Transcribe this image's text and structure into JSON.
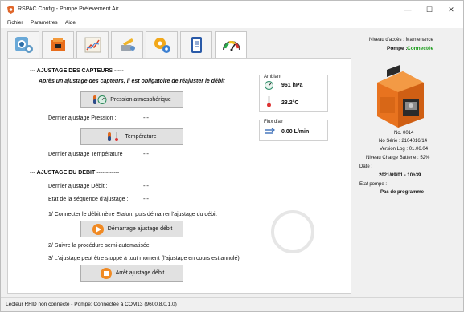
{
  "window": {
    "title": "RSPAC Config - Pompe Prélevement Air",
    "controls": [
      "—",
      "☐",
      "✕"
    ]
  },
  "menu": [
    "Fichier",
    "Paramètres",
    "Aide"
  ],
  "tabs": [
    {
      "icon": "sensor-tab-icon"
    },
    {
      "icon": "pump-tab-icon"
    },
    {
      "icon": "chart-tab-icon"
    },
    {
      "icon": "tools-tab-icon"
    },
    {
      "icon": "gears-tab-icon"
    },
    {
      "icon": "checklist-tab-icon"
    },
    {
      "icon": "gauge-tab-icon",
      "active": true
    }
  ],
  "calib": {
    "sensors_heading": "--- AJUSTAGE DES CAPTEURS -----",
    "sensors_warning": "Après un ajustage des capteurs, il est obligatoire de réajuster le débit",
    "pressure_button": "Pression atmosphérique",
    "last_pressure_label": "Dernier ajustage Pression :",
    "last_pressure_value": "---",
    "temperature_button": "Température",
    "last_temperature_label": "Dernier ajustage Température :",
    "last_temperature_value": "---",
    "flow_heading": "--- AJUSTAGE DU DEBIT ------------",
    "last_flow_label": "Dernier ajustage Débit :",
    "last_flow_value": "---",
    "sequence_label": "Etat de la séquence d'ajustage :",
    "sequence_value": "---",
    "step1": "1/ Connecter le débitmètre Etalon, puis démarrer l'ajustage du débit",
    "start_button": "Démarrage ajustage débit",
    "step2": "2/ Suivre la procédure semi-automatisée",
    "step3": "3/ L'ajustage peut être stoppé à tout moment (l'ajustage en cours est annulé)",
    "stop_button": "Arrêt ajustage débit"
  },
  "ambient": {
    "title": "Ambiant",
    "pressure": "961 hPa",
    "temperature": "23.2°C"
  },
  "airflow": {
    "title": "Flux d'air",
    "value": "0.00 L/min"
  },
  "device": {
    "access_level": "Niveau d'accès : Maintenance",
    "pump_label": "Pompe :",
    "pump_status": "Connectée",
    "pump_status_color": "#1a9c1a",
    "number": "No. 0014",
    "serial": "No Série : 2104016/14",
    "log_version": "Version Log : 01.06.04",
    "battery": "Niveau Charge Batterie : 52%",
    "date_label": "Date :",
    "date_value": "2021/09/01 - 10h39",
    "state_label": "Etat pompe :",
    "state_value": "Pas de programme"
  },
  "status_bar": "Lecteur RFID non connecté - Pompe: Connectée à COM13 (9600,8,0,1,0)",
  "colors": {
    "accent_orange": "#f08a24",
    "window_bg": "#f0f0f0",
    "button_bg": "#e1e1e1"
  }
}
